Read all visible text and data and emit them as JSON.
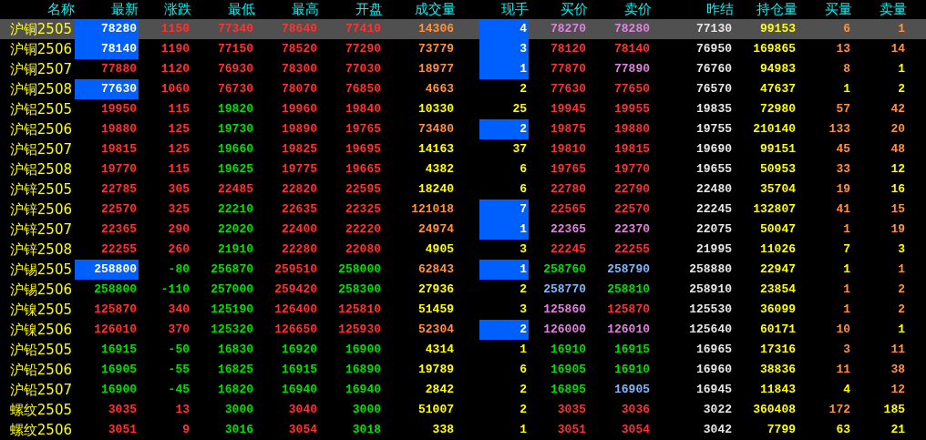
{
  "columns": [
    "名称",
    "最新",
    "涨跌",
    "最低",
    "最高",
    "开盘",
    "成交量",
    "现手",
    "买价",
    "卖价",
    "昨结",
    "持仓量",
    "买量",
    "卖量"
  ],
  "rows": [
    {
      "name": "沪铜2505",
      "selected": true,
      "last_flash": true,
      "lots_flash": true,
      "cells": [
        {
          "text": "78280",
          "color": "#ffffff"
        },
        {
          "text": "1150",
          "color": "#ff3232"
        },
        {
          "text": "77340",
          "color": "#ff3232"
        },
        {
          "text": "78640",
          "color": "#ff3232"
        },
        {
          "text": "77410",
          "color": "#ff3232"
        },
        {
          "text": "14306",
          "color": "#ff9040"
        },
        {
          "text": "4",
          "color": "#ffffff"
        },
        {
          "text": "78270",
          "color": "#e080e0"
        },
        {
          "text": "78280",
          "color": "#e080e0"
        },
        {
          "text": "77130",
          "color": "#e6e6e6"
        },
        {
          "text": "99153",
          "color": "#ffff00"
        },
        {
          "text": "6",
          "color": "#ff9040"
        },
        {
          "text": "1",
          "color": "#ff9040"
        }
      ]
    },
    {
      "name": "沪铜2506",
      "selected": false,
      "last_flash": true,
      "lots_flash": true,
      "cells": [
        {
          "text": "78140",
          "color": "#ffffff"
        },
        {
          "text": "1190",
          "color": "#ff3232"
        },
        {
          "text": "77150",
          "color": "#ff3232"
        },
        {
          "text": "78520",
          "color": "#ff3232"
        },
        {
          "text": "77290",
          "color": "#ff3232"
        },
        {
          "text": "73779",
          "color": "#ff9040"
        },
        {
          "text": "3",
          "color": "#ffffff"
        },
        {
          "text": "78120",
          "color": "#ff3232"
        },
        {
          "text": "78140",
          "color": "#ff3232"
        },
        {
          "text": "76950",
          "color": "#e6e6e6"
        },
        {
          "text": "169865",
          "color": "#ffff00"
        },
        {
          "text": "13",
          "color": "#ff9040"
        },
        {
          "text": "14",
          "color": "#ff9040"
        }
      ]
    },
    {
      "name": "沪铜2507",
      "selected": false,
      "last_flash": false,
      "lots_flash": true,
      "cells": [
        {
          "text": "77880",
          "color": "#ff3232"
        },
        {
          "text": "1120",
          "color": "#ff3232"
        },
        {
          "text": "76930",
          "color": "#ff3232"
        },
        {
          "text": "78300",
          "color": "#ff3232"
        },
        {
          "text": "77030",
          "color": "#ff3232"
        },
        {
          "text": "18977",
          "color": "#ff9040"
        },
        {
          "text": "1",
          "color": "#ffffff"
        },
        {
          "text": "77870",
          "color": "#ff3232"
        },
        {
          "text": "77890",
          "color": "#e080e0"
        },
        {
          "text": "76760",
          "color": "#e6e6e6"
        },
        {
          "text": "94983",
          "color": "#ffff00"
        },
        {
          "text": "8",
          "color": "#ff9040"
        },
        {
          "text": "1",
          "color": "#ffff00"
        }
      ]
    },
    {
      "name": "沪铜2508",
      "selected": false,
      "last_flash": true,
      "lots_flash": false,
      "cells": [
        {
          "text": "77630",
          "color": "#ffffff"
        },
        {
          "text": "1060",
          "color": "#ff3232"
        },
        {
          "text": "76730",
          "color": "#ff3232"
        },
        {
          "text": "78070",
          "color": "#ff3232"
        },
        {
          "text": "76850",
          "color": "#ff3232"
        },
        {
          "text": "4663",
          "color": "#ff9040"
        },
        {
          "text": "2",
          "color": "#ffff00"
        },
        {
          "text": "77630",
          "color": "#ff3232"
        },
        {
          "text": "77650",
          "color": "#ff3232"
        },
        {
          "text": "76570",
          "color": "#e6e6e6"
        },
        {
          "text": "47637",
          "color": "#ffff00"
        },
        {
          "text": "1",
          "color": "#ffff00"
        },
        {
          "text": "2",
          "color": "#ffff00"
        }
      ]
    },
    {
      "name": "沪铝2505",
      "selected": false,
      "last_flash": false,
      "lots_flash": false,
      "cells": [
        {
          "text": "19950",
          "color": "#ff3232"
        },
        {
          "text": "115",
          "color": "#ff3232"
        },
        {
          "text": "19820",
          "color": "#00e000"
        },
        {
          "text": "19960",
          "color": "#ff3232"
        },
        {
          "text": "19840",
          "color": "#ff3232"
        },
        {
          "text": "10330",
          "color": "#ffff00"
        },
        {
          "text": "25",
          "color": "#ffff00"
        },
        {
          "text": "19945",
          "color": "#ff3232"
        },
        {
          "text": "19955",
          "color": "#ff3232"
        },
        {
          "text": "19835",
          "color": "#e6e6e6"
        },
        {
          "text": "72980",
          "color": "#ffff00"
        },
        {
          "text": "57",
          "color": "#ff9040"
        },
        {
          "text": "42",
          "color": "#ff9040"
        }
      ]
    },
    {
      "name": "沪铝2506",
      "selected": false,
      "last_flash": false,
      "lots_flash": true,
      "cells": [
        {
          "text": "19880",
          "color": "#ff3232"
        },
        {
          "text": "125",
          "color": "#ff3232"
        },
        {
          "text": "19730",
          "color": "#00e000"
        },
        {
          "text": "19890",
          "color": "#ff3232"
        },
        {
          "text": "19765",
          "color": "#ff3232"
        },
        {
          "text": "73480",
          "color": "#ff9040"
        },
        {
          "text": "2",
          "color": "#ffffff"
        },
        {
          "text": "19875",
          "color": "#ff3232"
        },
        {
          "text": "19880",
          "color": "#ff3232"
        },
        {
          "text": "19755",
          "color": "#e6e6e6"
        },
        {
          "text": "210140",
          "color": "#ffff00"
        },
        {
          "text": "133",
          "color": "#ff9040"
        },
        {
          "text": "20",
          "color": "#ff9040"
        }
      ]
    },
    {
      "name": "沪铝2507",
      "selected": false,
      "last_flash": false,
      "lots_flash": false,
      "cells": [
        {
          "text": "19815",
          "color": "#ff3232"
        },
        {
          "text": "125",
          "color": "#ff3232"
        },
        {
          "text": "19660",
          "color": "#00e000"
        },
        {
          "text": "19825",
          "color": "#ff3232"
        },
        {
          "text": "19695",
          "color": "#ff3232"
        },
        {
          "text": "14163",
          "color": "#ffff00"
        },
        {
          "text": "37",
          "color": "#ffff00"
        },
        {
          "text": "19810",
          "color": "#ff3232"
        },
        {
          "text": "19815",
          "color": "#ff3232"
        },
        {
          "text": "19690",
          "color": "#e6e6e6"
        },
        {
          "text": "99151",
          "color": "#ffff00"
        },
        {
          "text": "45",
          "color": "#ff9040"
        },
        {
          "text": "48",
          "color": "#ff9040"
        }
      ]
    },
    {
      "name": "沪铝2508",
      "selected": false,
      "last_flash": false,
      "lots_flash": false,
      "cells": [
        {
          "text": "19770",
          "color": "#ff3232"
        },
        {
          "text": "115",
          "color": "#ff3232"
        },
        {
          "text": "19625",
          "color": "#00e000"
        },
        {
          "text": "19775",
          "color": "#ff3232"
        },
        {
          "text": "19665",
          "color": "#ff3232"
        },
        {
          "text": "4382",
          "color": "#ffff00"
        },
        {
          "text": "6",
          "color": "#ffff00"
        },
        {
          "text": "19765",
          "color": "#ff3232"
        },
        {
          "text": "19770",
          "color": "#ff3232"
        },
        {
          "text": "19655",
          "color": "#e6e6e6"
        },
        {
          "text": "50953",
          "color": "#ffff00"
        },
        {
          "text": "33",
          "color": "#ff9040"
        },
        {
          "text": "12",
          "color": "#ffff00"
        }
      ]
    },
    {
      "name": "沪锌2505",
      "selected": false,
      "last_flash": false,
      "lots_flash": false,
      "cells": [
        {
          "text": "22785",
          "color": "#ff3232"
        },
        {
          "text": "305",
          "color": "#ff3232"
        },
        {
          "text": "22485",
          "color": "#ff3232"
        },
        {
          "text": "22820",
          "color": "#ff3232"
        },
        {
          "text": "22595",
          "color": "#ff3232"
        },
        {
          "text": "18240",
          "color": "#ffff00"
        },
        {
          "text": "6",
          "color": "#ffff00"
        },
        {
          "text": "22780",
          "color": "#ff3232"
        },
        {
          "text": "22790",
          "color": "#ff3232"
        },
        {
          "text": "22480",
          "color": "#e6e6e6"
        },
        {
          "text": "35704",
          "color": "#ffff00"
        },
        {
          "text": "19",
          "color": "#ff9040"
        },
        {
          "text": "16",
          "color": "#ffff00"
        }
      ]
    },
    {
      "name": "沪锌2506",
      "selected": false,
      "last_flash": false,
      "lots_flash": true,
      "cells": [
        {
          "text": "22570",
          "color": "#ff3232"
        },
        {
          "text": "325",
          "color": "#ff3232"
        },
        {
          "text": "22210",
          "color": "#00e000"
        },
        {
          "text": "22635",
          "color": "#ff3232"
        },
        {
          "text": "22325",
          "color": "#ff3232"
        },
        {
          "text": "121018",
          "color": "#ff9040"
        },
        {
          "text": "7",
          "color": "#ffffff"
        },
        {
          "text": "22565",
          "color": "#ff3232"
        },
        {
          "text": "22570",
          "color": "#ff3232"
        },
        {
          "text": "22245",
          "color": "#e6e6e6"
        },
        {
          "text": "132807",
          "color": "#ffff00"
        },
        {
          "text": "41",
          "color": "#ff9040"
        },
        {
          "text": "15",
          "color": "#ff9040"
        }
      ]
    },
    {
      "name": "沪锌2507",
      "selected": false,
      "last_flash": false,
      "lots_flash": true,
      "cells": [
        {
          "text": "22365",
          "color": "#ff3232"
        },
        {
          "text": "290",
          "color": "#ff3232"
        },
        {
          "text": "22020",
          "color": "#00e000"
        },
        {
          "text": "22400",
          "color": "#ff3232"
        },
        {
          "text": "22220",
          "color": "#ff3232"
        },
        {
          "text": "24974",
          "color": "#ff9040"
        },
        {
          "text": "1",
          "color": "#ffffff"
        },
        {
          "text": "22365",
          "color": "#e080e0"
        },
        {
          "text": "22370",
          "color": "#e080e0"
        },
        {
          "text": "22075",
          "color": "#e6e6e6"
        },
        {
          "text": "50047",
          "color": "#ffff00"
        },
        {
          "text": "1",
          "color": "#ff9040"
        },
        {
          "text": "19",
          "color": "#ff9040"
        }
      ]
    },
    {
      "name": "沪锌2508",
      "selected": false,
      "last_flash": false,
      "lots_flash": false,
      "cells": [
        {
          "text": "22255",
          "color": "#ff3232"
        },
        {
          "text": "260",
          "color": "#ff3232"
        },
        {
          "text": "21910",
          "color": "#00e000"
        },
        {
          "text": "22280",
          "color": "#ff3232"
        },
        {
          "text": "22080",
          "color": "#ff3232"
        },
        {
          "text": "4905",
          "color": "#ffff00"
        },
        {
          "text": "3",
          "color": "#ffff00"
        },
        {
          "text": "22245",
          "color": "#ff3232"
        },
        {
          "text": "22255",
          "color": "#ff3232"
        },
        {
          "text": "21995",
          "color": "#e6e6e6"
        },
        {
          "text": "11026",
          "color": "#ffff00"
        },
        {
          "text": "7",
          "color": "#ffff00"
        },
        {
          "text": "3",
          "color": "#ffff00"
        }
      ]
    },
    {
      "name": "沪锡2505",
      "selected": false,
      "last_flash": true,
      "lots_flash": true,
      "cells": [
        {
          "text": "258800",
          "color": "#ffffff"
        },
        {
          "text": "-80",
          "color": "#00e000"
        },
        {
          "text": "256870",
          "color": "#00e000"
        },
        {
          "text": "259510",
          "color": "#ff3232"
        },
        {
          "text": "258000",
          "color": "#00e000"
        },
        {
          "text": "62843",
          "color": "#ff9040"
        },
        {
          "text": "1",
          "color": "#ffffff"
        },
        {
          "text": "258760",
          "color": "#00e000"
        },
        {
          "text": "258790",
          "color": "#80b8ff"
        },
        {
          "text": "258880",
          "color": "#e6e6e6"
        },
        {
          "text": "22947",
          "color": "#ffff00"
        },
        {
          "text": "1",
          "color": "#ffff00"
        },
        {
          "text": "1",
          "color": "#ff9040"
        }
      ]
    },
    {
      "name": "沪锡2506",
      "selected": false,
      "last_flash": false,
      "lots_flash": false,
      "cells": [
        {
          "text": "258800",
          "color": "#00e000"
        },
        {
          "text": "-110",
          "color": "#00e000"
        },
        {
          "text": "257000",
          "color": "#00e000"
        },
        {
          "text": "259420",
          "color": "#ff3232"
        },
        {
          "text": "258300",
          "color": "#00e000"
        },
        {
          "text": "27936",
          "color": "#ffff00"
        },
        {
          "text": "2",
          "color": "#ffff00"
        },
        {
          "text": "258770",
          "color": "#80b8ff"
        },
        {
          "text": "258810",
          "color": "#00e000"
        },
        {
          "text": "258910",
          "color": "#e6e6e6"
        },
        {
          "text": "23854",
          "color": "#ffff00"
        },
        {
          "text": "1",
          "color": "#ff9040"
        },
        {
          "text": "2",
          "color": "#ff9040"
        }
      ]
    },
    {
      "name": "沪镍2505",
      "selected": false,
      "last_flash": false,
      "lots_flash": false,
      "cells": [
        {
          "text": "125870",
          "color": "#ff3232"
        },
        {
          "text": "340",
          "color": "#ff3232"
        },
        {
          "text": "125190",
          "color": "#00e000"
        },
        {
          "text": "126400",
          "color": "#ff3232"
        },
        {
          "text": "125810",
          "color": "#ff3232"
        },
        {
          "text": "51459",
          "color": "#ffff00"
        },
        {
          "text": "3",
          "color": "#ffff00"
        },
        {
          "text": "125860",
          "color": "#e080e0"
        },
        {
          "text": "125870",
          "color": "#ff3232"
        },
        {
          "text": "125530",
          "color": "#e6e6e6"
        },
        {
          "text": "36099",
          "color": "#ffff00"
        },
        {
          "text": "1",
          "color": "#ff9040"
        },
        {
          "text": "2",
          "color": "#ff9040"
        }
      ]
    },
    {
      "name": "沪镍2506",
      "selected": false,
      "last_flash": false,
      "lots_flash": true,
      "cells": [
        {
          "text": "126010",
          "color": "#ff3232"
        },
        {
          "text": "370",
          "color": "#ff3232"
        },
        {
          "text": "125320",
          "color": "#00e000"
        },
        {
          "text": "126650",
          "color": "#ff3232"
        },
        {
          "text": "125930",
          "color": "#ff3232"
        },
        {
          "text": "52304",
          "color": "#ff9040"
        },
        {
          "text": "2",
          "color": "#ffffff"
        },
        {
          "text": "126000",
          "color": "#e080e0"
        },
        {
          "text": "126010",
          "color": "#e080e0"
        },
        {
          "text": "125640",
          "color": "#e6e6e6"
        },
        {
          "text": "60171",
          "color": "#ffff00"
        },
        {
          "text": "10",
          "color": "#ff9040"
        },
        {
          "text": "1",
          "color": "#ffff00"
        }
      ]
    },
    {
      "name": "沪铅2505",
      "selected": false,
      "last_flash": false,
      "lots_flash": false,
      "cells": [
        {
          "text": "16915",
          "color": "#00e000"
        },
        {
          "text": "-50",
          "color": "#00e000"
        },
        {
          "text": "16830",
          "color": "#00e000"
        },
        {
          "text": "16920",
          "color": "#00e000"
        },
        {
          "text": "16900",
          "color": "#00e000"
        },
        {
          "text": "4314",
          "color": "#ffff00"
        },
        {
          "text": "1",
          "color": "#ffff00"
        },
        {
          "text": "16910",
          "color": "#00e000"
        },
        {
          "text": "16915",
          "color": "#00e000"
        },
        {
          "text": "16965",
          "color": "#e6e6e6"
        },
        {
          "text": "17316",
          "color": "#ffff00"
        },
        {
          "text": "3",
          "color": "#ff9040"
        },
        {
          "text": "11",
          "color": "#ff9040"
        }
      ]
    },
    {
      "name": "沪铅2506",
      "selected": false,
      "last_flash": false,
      "lots_flash": false,
      "cells": [
        {
          "text": "16905",
          "color": "#00e000"
        },
        {
          "text": "-55",
          "color": "#00e000"
        },
        {
          "text": "16825",
          "color": "#00e000"
        },
        {
          "text": "16915",
          "color": "#00e000"
        },
        {
          "text": "16890",
          "color": "#00e000"
        },
        {
          "text": "19789",
          "color": "#ffff00"
        },
        {
          "text": "6",
          "color": "#ffff00"
        },
        {
          "text": "16905",
          "color": "#00e000"
        },
        {
          "text": "16910",
          "color": "#00e000"
        },
        {
          "text": "16960",
          "color": "#e6e6e6"
        },
        {
          "text": "38836",
          "color": "#ffff00"
        },
        {
          "text": "11",
          "color": "#ff9040"
        },
        {
          "text": "38",
          "color": "#ff9040"
        }
      ]
    },
    {
      "name": "沪铅2507",
      "selected": false,
      "last_flash": false,
      "lots_flash": false,
      "cells": [
        {
          "text": "16900",
          "color": "#00e000"
        },
        {
          "text": "-45",
          "color": "#00e000"
        },
        {
          "text": "16820",
          "color": "#00e000"
        },
        {
          "text": "16940",
          "color": "#00e000"
        },
        {
          "text": "16940",
          "color": "#00e000"
        },
        {
          "text": "2842",
          "color": "#ffff00"
        },
        {
          "text": "2",
          "color": "#ffff00"
        },
        {
          "text": "16895",
          "color": "#00e000"
        },
        {
          "text": "16905",
          "color": "#80b8ff"
        },
        {
          "text": "16945",
          "color": "#e6e6e6"
        },
        {
          "text": "11843",
          "color": "#ffff00"
        },
        {
          "text": "4",
          "color": "#ffff00"
        },
        {
          "text": "12",
          "color": "#ff9040"
        }
      ]
    },
    {
      "name": "螺纹2505",
      "selected": false,
      "last_flash": false,
      "lots_flash": false,
      "cells": [
        {
          "text": "3035",
          "color": "#ff3232"
        },
        {
          "text": "13",
          "color": "#ff3232"
        },
        {
          "text": "3000",
          "color": "#00e000"
        },
        {
          "text": "3040",
          "color": "#ff3232"
        },
        {
          "text": "3000",
          "color": "#00e000"
        },
        {
          "text": "51007",
          "color": "#ffff00"
        },
        {
          "text": "2",
          "color": "#ffff00"
        },
        {
          "text": "3035",
          "color": "#ff3232"
        },
        {
          "text": "3036",
          "color": "#ff3232"
        },
        {
          "text": "3022",
          "color": "#e6e6e6"
        },
        {
          "text": "360408",
          "color": "#ffff00"
        },
        {
          "text": "172",
          "color": "#ff9040"
        },
        {
          "text": "185",
          "color": "#ffff00"
        }
      ]
    },
    {
      "name": "螺纹2506",
      "selected": false,
      "last_flash": false,
      "lots_flash": false,
      "cells": [
        {
          "text": "3051",
          "color": "#ff3232"
        },
        {
          "text": "9",
          "color": "#ff3232"
        },
        {
          "text": "3016",
          "color": "#00e000"
        },
        {
          "text": "3054",
          "color": "#ff3232"
        },
        {
          "text": "3018",
          "color": "#00e000"
        },
        {
          "text": "338",
          "color": "#ffff00"
        },
        {
          "text": "1",
          "color": "#ffff00"
        },
        {
          "text": "3051",
          "color": "#ff3232"
        },
        {
          "text": "3054",
          "color": "#ff3232"
        },
        {
          "text": "3042",
          "color": "#e6e6e6"
        },
        {
          "text": "7799",
          "color": "#ffff00"
        },
        {
          "text": "63",
          "color": "#ffff00"
        },
        {
          "text": "21",
          "color": "#ffff00"
        }
      ]
    }
  ]
}
